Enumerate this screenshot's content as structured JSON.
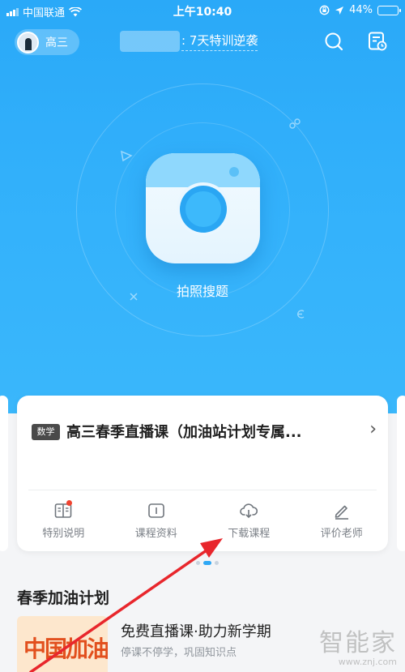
{
  "status_bar": {
    "carrier": "中国联通",
    "time": "上午10:40",
    "battery": "44%",
    "battery_level": 0.44
  },
  "header": {
    "grade": "高三",
    "promo_text": "7天特训逆袭",
    "icons": [
      "search-icon",
      "schedule-icon"
    ]
  },
  "camera": {
    "label": "拍照搜题"
  },
  "course_card": {
    "subject_tag": "数学",
    "title": "高三春季直播课（加油站计划专属...",
    "actions": [
      {
        "label": "特别说明",
        "icon": "book-icon",
        "has_badge": true
      },
      {
        "label": "课程资料",
        "icon": "notebook-icon",
        "has_badge": false
      },
      {
        "label": "下载课程",
        "icon": "cloud-download-icon",
        "has_badge": false
      },
      {
        "label": "评价老师",
        "icon": "pencil-icon",
        "has_badge": false
      }
    ]
  },
  "pager": {
    "count": 3,
    "active_index": 1
  },
  "section": {
    "title": "春季加油计划"
  },
  "live_item": {
    "image_text": "中国加油",
    "title": "免费直播课·助力新学期",
    "subtitle": "停课不停学，巩固知识点"
  },
  "watermark": {
    "brand": "智能家",
    "url": "www.znj.com"
  },
  "colors": {
    "hero_blue": "#2aa9f8",
    "accent_blue": "#2fa8f5",
    "arrow_red": "#e8262c",
    "badge_red": "#f0432f"
  }
}
